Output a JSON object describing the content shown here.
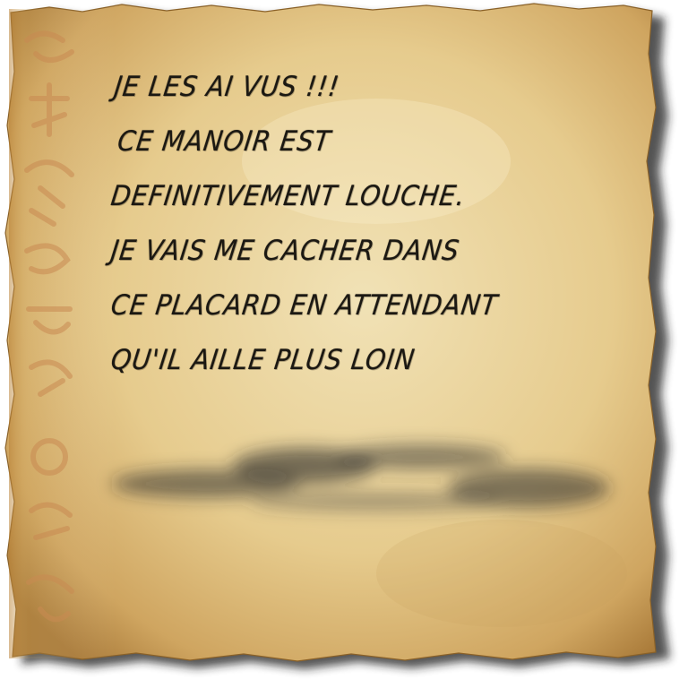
{
  "note": {
    "lines": [
      "JE LES AI VUS !!!",
      "CE MANOIR EST",
      "DEFINITIVEMENT LOUCHE.",
      "JE VAIS ME CACHER DANS",
      "CE PLACARD EN ATTENDANT",
      "QU'IL AILLE PLUS LOIN"
    ]
  },
  "colors": {
    "paper": "#e9cf94",
    "paper_edge": "#b58a45",
    "ink": "#1b1812",
    "glyphs": "#c98a52",
    "shadow": "#2a2a2a"
  },
  "decor": {
    "left_border": "faded-glyph-column",
    "smudge": "ink-smudge"
  }
}
